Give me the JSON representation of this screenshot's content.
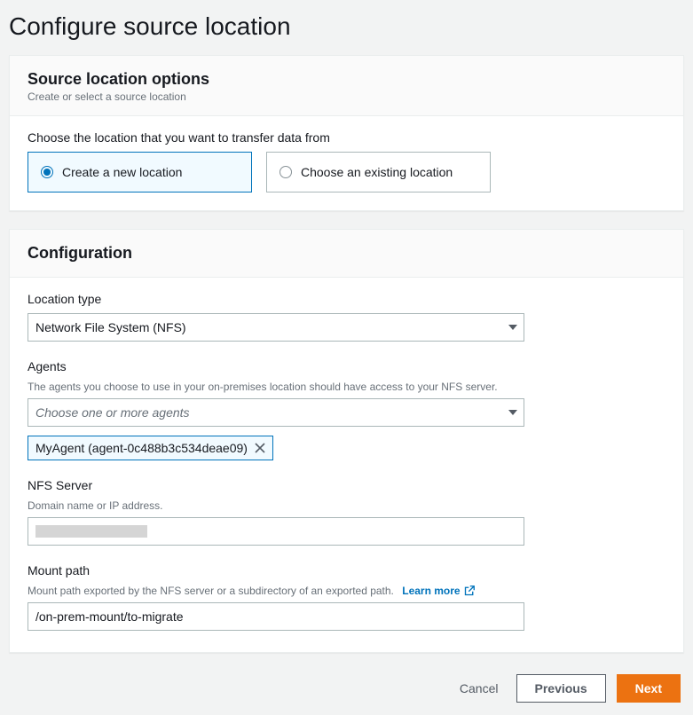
{
  "page": {
    "title": "Configure source location"
  },
  "sourceOptions": {
    "heading": "Source location options",
    "subtitle": "Create or select a source location",
    "prompt": "Choose the location that you want to transfer data from",
    "options": {
      "create": "Create a new location",
      "existing": "Choose an existing location"
    }
  },
  "configuration": {
    "heading": "Configuration",
    "locationType": {
      "label": "Location type",
      "value": "Network File System (NFS)"
    },
    "agents": {
      "label": "Agents",
      "help": "The agents you choose to use in your on-premises location should have access to your NFS server.",
      "placeholder": "Choose one or more agents",
      "selected": "MyAgent (agent-0c488b3c534deae09)"
    },
    "nfsServer": {
      "label": "NFS Server",
      "help": "Domain name or IP address."
    },
    "mountPath": {
      "label": "Mount path",
      "help": "Mount path exported by the NFS server or a subdirectory of an exported path.",
      "learnMore": "Learn more",
      "value": "/on-prem-mount/to-migrate"
    }
  },
  "footer": {
    "cancel": "Cancel",
    "previous": "Previous",
    "next": "Next"
  }
}
